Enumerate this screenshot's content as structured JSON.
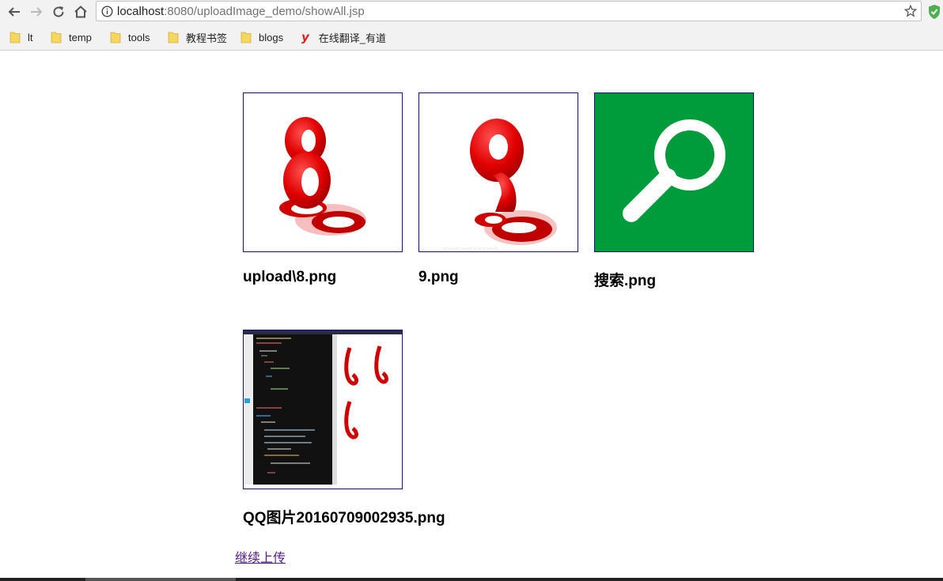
{
  "browser": {
    "address": {
      "host": "localhost",
      "path": ":8080/uploadImage_demo/showAll.jsp"
    },
    "bookmarks": [
      {
        "label": "lt",
        "icon": "folder-icon"
      },
      {
        "label": "temp",
        "icon": "folder-icon"
      },
      {
        "label": "tools",
        "icon": "folder-icon"
      },
      {
        "label": "教程书签",
        "icon": "folder-icon"
      },
      {
        "label": "blogs",
        "icon": "folder-icon"
      },
      {
        "label": "在线翻译_有道",
        "icon": "youdao-icon"
      }
    ]
  },
  "images": [
    {
      "caption": "upload\\8.png",
      "kind": "red-digit",
      "digit": "8"
    },
    {
      "caption": "9.png",
      "kind": "red-digit",
      "digit": "9"
    },
    {
      "caption": "搜索.png",
      "kind": "search-icon",
      "color": "#009c3b"
    },
    {
      "caption": "QQ图片20160709002935.png",
      "kind": "code-screenshot"
    }
  ],
  "upload_link": "继续上传",
  "colors": {
    "thumb_border": "#1010a0",
    "search_bg": "#009c3b",
    "digit_red": "#e00000",
    "visited_link": "#551a8b"
  }
}
